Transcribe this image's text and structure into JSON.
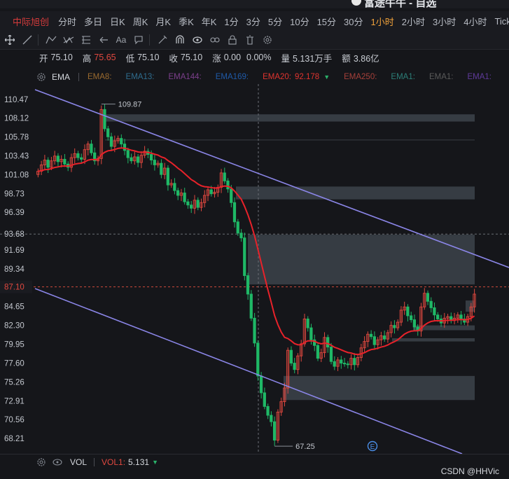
{
  "app": {
    "title": "富途牛牛 - 自选"
  },
  "periods": {
    "stock_name": "中际旭创",
    "items": [
      "分时",
      "多日",
      "日K",
      "周K",
      "月K",
      "季K",
      "年K",
      "1分",
      "3分",
      "5分",
      "10分",
      "15分",
      "30分",
      "1小时",
      "2小时",
      "3小时",
      "4小时",
      "Tick"
    ],
    "active_index": 13
  },
  "toolbar": {
    "icons": [
      "crosshair-icon",
      "line-icon",
      "polyline-icon",
      "pattern-icon",
      "fib-icon",
      "arrow-icon",
      "text-tool-icon",
      "comment-icon",
      "pen-icon",
      "magnet-icon",
      "eye-icon",
      "link-icon",
      "lock-icon",
      "trash-icon",
      "settings-icon"
    ]
  },
  "quote": {
    "open_label": "开",
    "open": "75.10",
    "high_label": "高",
    "high": "75.65",
    "low_label": "低",
    "low": "75.10",
    "close_label": "收",
    "close": "75.10",
    "change_label": "涨",
    "change": "0.00",
    "change_pct": "0.00%",
    "volume_label": "量",
    "volume": "5.131万手",
    "amount_label": "额",
    "amount": "3.86亿"
  },
  "ema": {
    "name": "EMA",
    "items": [
      {
        "label": "EMA8:",
        "value": "",
        "color": "#9a6a2f"
      },
      {
        "label": "EMA13:",
        "value": "",
        "color": "#2f6d8f"
      },
      {
        "label": "EMA144:",
        "value": "",
        "color": "#7c3f8c"
      },
      {
        "label": "EMA169:",
        "value": "",
        "color": "#1f5aa8"
      },
      {
        "label": "EMA20:",
        "value": "92.178",
        "color": "#e0342f"
      },
      {
        "label": "EMA250:",
        "value": "",
        "color": "#a6403a"
      },
      {
        "label": "EMA1:",
        "value": "",
        "color": "#2c7f78"
      },
      {
        "label": "EMA1:",
        "value": "",
        "color": "#5a5a5a"
      },
      {
        "label": "EMA1:",
        "value": "",
        "color": "#5f3a9a"
      }
    ]
  },
  "price_axis": {
    "labels": [
      "110.47",
      "108.12",
      "105.78",
      "103.43",
      "101.08",
      "98.73",
      "96.39",
      "93.68",
      "91.69",
      "89.34",
      "87.10",
      "84.65",
      "82.30",
      "79.95",
      "77.60",
      "75.26",
      "72.91",
      "70.56",
      "68.21"
    ],
    "highlight_current": "87.10",
    "highlight_cursor": "93.68"
  },
  "annotations": {
    "high": "109.87",
    "low": "67.25",
    "event_marker": "E"
  },
  "vol": {
    "name": "VOL",
    "label": "VOL1:",
    "value": "5.131"
  },
  "watermark": "CSDN @HHVic",
  "colors": {
    "up": "#e0483f",
    "down": "#1fb866",
    "ema20": "#e8222a",
    "channel": "#8b86e8",
    "zone": "#3a4048"
  },
  "chart_data": {
    "type": "candlestick",
    "ylim": [
      67.0,
      111.5
    ],
    "close": [
      101.5,
      102.3,
      102.9,
      102.0,
      102.8,
      103.4,
      102.7,
      103.0,
      102.4,
      102.0,
      103.2,
      103.7,
      103.2,
      103.0,
      104.2,
      104.9,
      103.8,
      102.8,
      103.1,
      109.2,
      106.8,
      105.8,
      104.6,
      105.3,
      105.6,
      104.9,
      104.1,
      103.2,
      102.8,
      103.3,
      102.6,
      103.5,
      104.0,
      103.6,
      102.9,
      102.3,
      102.5,
      101.1,
      101.9,
      99.8,
      100.0,
      99.1,
      98.5,
      98.8,
      97.7,
      97.3,
      96.9,
      97.9,
      97.0,
      97.6,
      98.5,
      99.2,
      98.7,
      98.9,
      99.5,
      101.3,
      100.3,
      99.3,
      97.6,
      95.2,
      93.8,
      93.2,
      88.5,
      86.2,
      83.2,
      80.1,
      76.0,
      73.9,
      72.2,
      71.1,
      70.3,
      68.0,
      71.5,
      72.8,
      74.5,
      79.2,
      77.6,
      76.8,
      78.5,
      80.0,
      83.1,
      82.0,
      80.5,
      79.8,
      78.2,
      78.9,
      80.8,
      79.6,
      77.8,
      77.2,
      78.0,
      77.6,
      77.5,
      77.4,
      78.2,
      77.4,
      78.3,
      79.5,
      80.3,
      81.2,
      80.9,
      79.9,
      80.5,
      81.0,
      80.6,
      81.4,
      82.3,
      82.0,
      82.7,
      84.2,
      84.6,
      83.5,
      83.0,
      82.1,
      81.6,
      84.6,
      86.3,
      85.3,
      84.5,
      83.6,
      83.1,
      82.6,
      83.2,
      83.4,
      82.9,
      83.2,
      83.6,
      83.1,
      82.7,
      83.4,
      84.6,
      86.2
    ]
  }
}
